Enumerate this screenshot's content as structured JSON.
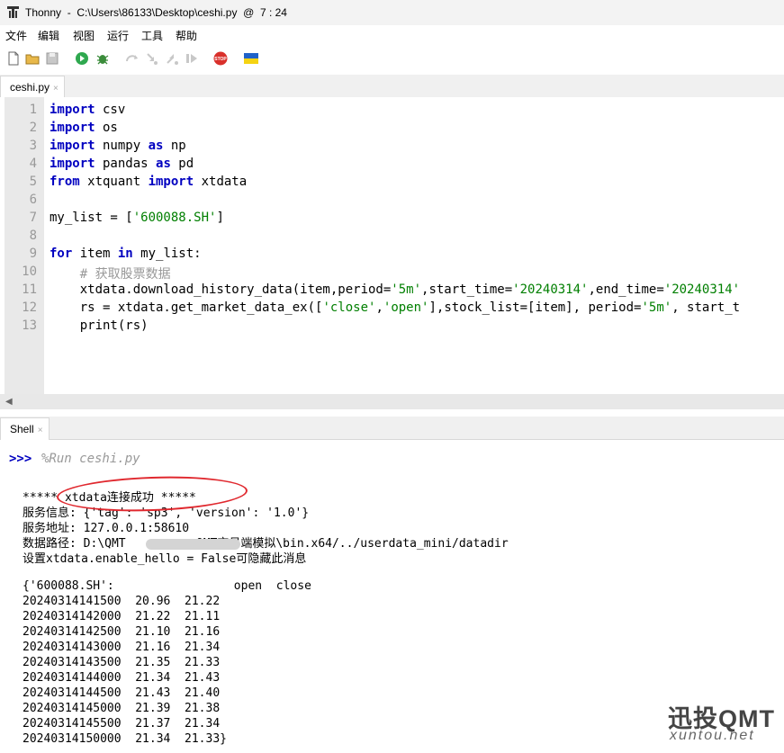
{
  "window": {
    "title": "Thonny  -  C:\\Users\\86133\\Desktop\\ceshi.py  @  7 : 24"
  },
  "menu": [
    "文件",
    "编辑",
    "视图",
    "运行",
    "工具",
    "帮助"
  ],
  "toolbar": {
    "icons": [
      "new-file-icon",
      "open-file-icon",
      "save-icon",
      "run-icon",
      "debug-icon",
      "step-over-icon",
      "step-into-icon",
      "step-out-icon",
      "resume-icon",
      "stop-icon",
      "ukraine-flag-icon"
    ],
    "stop_label": "STOP"
  },
  "editor": {
    "tab": {
      "label": "ceshi.py",
      "close": "×"
    },
    "line_numbers": [
      "1",
      "2",
      "3",
      "4",
      "5",
      "6",
      "7",
      "8",
      "9",
      "10",
      "11",
      "12",
      "13"
    ],
    "lines": [
      [
        {
          "t": "import",
          "c": "kw"
        },
        {
          "t": " csv"
        }
      ],
      [
        {
          "t": "import",
          "c": "kw"
        },
        {
          "t": " os"
        }
      ],
      [
        {
          "t": "import",
          "c": "kw"
        },
        {
          "t": " numpy "
        },
        {
          "t": "as",
          "c": "kw"
        },
        {
          "t": " np"
        }
      ],
      [
        {
          "t": "import",
          "c": "kw"
        },
        {
          "t": " pandas "
        },
        {
          "t": "as",
          "c": "kw"
        },
        {
          "t": " pd"
        }
      ],
      [
        {
          "t": "from",
          "c": "kw"
        },
        {
          "t": " xtquant "
        },
        {
          "t": "import",
          "c": "kw"
        },
        {
          "t": " xtdata"
        }
      ],
      [],
      [
        {
          "t": "my_list = ["
        },
        {
          "t": "'600088.SH'",
          "c": "str"
        },
        {
          "t": "]"
        }
      ],
      [],
      [
        {
          "t": "for",
          "c": "kw"
        },
        {
          "t": " item "
        },
        {
          "t": "in",
          "c": "kw"
        },
        {
          "t": " my_list:"
        }
      ],
      [
        {
          "t": "    "
        },
        {
          "t": "# 获取股票数据",
          "c": "cm"
        }
      ],
      [
        {
          "t": "    xtdata.download_history_data(item,period="
        },
        {
          "t": "'5m'",
          "c": "str"
        },
        {
          "t": ",start_time="
        },
        {
          "t": "'20240314'",
          "c": "str"
        },
        {
          "t": ",end_time="
        },
        {
          "t": "'20240314'",
          "c": "str"
        }
      ],
      [
        {
          "t": "    rs = xtdata.get_market_data_ex(["
        },
        {
          "t": "'close'",
          "c": "str"
        },
        {
          "t": ","
        },
        {
          "t": "'open'",
          "c": "str"
        },
        {
          "t": "],stock_list=[item], period="
        },
        {
          "t": "'5m'",
          "c": "str"
        },
        {
          "t": ", start_t"
        }
      ],
      [
        {
          "t": "    print(rs)"
        }
      ]
    ]
  },
  "shell": {
    "tab": {
      "label": "Shell",
      "close": "×"
    },
    "prompt": ">>>",
    "run_command": "%Run ceshi.py",
    "output": [
      "***** xtdata连接成功 *****",
      "服务信息: {'tag': 'sp3', 'version': '1.0'}",
      "服务地址: 127.0.0.1:58610",
      "数据路径: D:\\QMT          QMT交易端模拟\\bin.x64/../userdata_mini/datadir",
      "设置xtdata.enable_hello = False可隐藏此消息",
      "",
      "{'600088.SH':                 open  close",
      "20240314141500  20.96  21.22",
      "20240314142000  21.22  21.11",
      "20240314142500  21.10  21.16",
      "20240314143000  21.16  21.34",
      "20240314143500  21.35  21.33",
      "20240314144000  21.34  21.43",
      "20240314144500  21.43  21.40",
      "20240314145000  21.39  21.38",
      "20240314145500  21.37  21.34",
      "20240314150000  21.34  21.33}"
    ]
  },
  "watermark": {
    "cn": "迅投QMT",
    "en": "xuntou.net"
  },
  "colors": {
    "keyword": "#0000c0",
    "string": "#007f00",
    "comment": "#999999",
    "annotation": "#e0282e"
  }
}
